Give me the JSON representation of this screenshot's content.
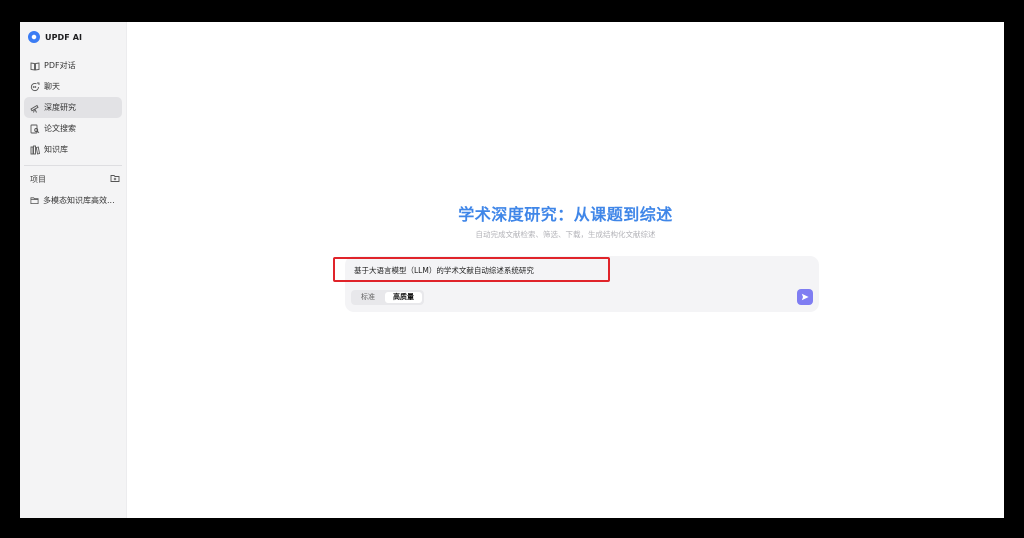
{
  "app": {
    "name": "UPDF AI"
  },
  "sidebar": {
    "items": [
      {
        "label": "PDF对话",
        "icon": "book-icon",
        "active": false
      },
      {
        "label": "聊天",
        "icon": "chat-icon",
        "active": false
      },
      {
        "label": "深度研究",
        "icon": "telescope-icon",
        "active": true
      },
      {
        "label": "论文搜索",
        "icon": "paper-search-icon",
        "active": false
      },
      {
        "label": "知识库",
        "icon": "library-icon",
        "active": false
      }
    ],
    "projects_label": "项目",
    "projects": [
      {
        "label": "多模态知识库高效..."
      }
    ]
  },
  "main": {
    "title": "学术深度研究：从课题到综述",
    "subtitle": "自动完成文献检索、筛选、下载，生成结构化文献综述",
    "query": "基于大语言模型（LLM）的学术文献自动综述系统研究",
    "modes": [
      {
        "label": "标准",
        "selected": false
      },
      {
        "label": "高质量",
        "selected": true
      }
    ]
  },
  "colors": {
    "accent": "#3f86e8",
    "send_button": "#7f7df2",
    "highlight": "#e0242a"
  }
}
